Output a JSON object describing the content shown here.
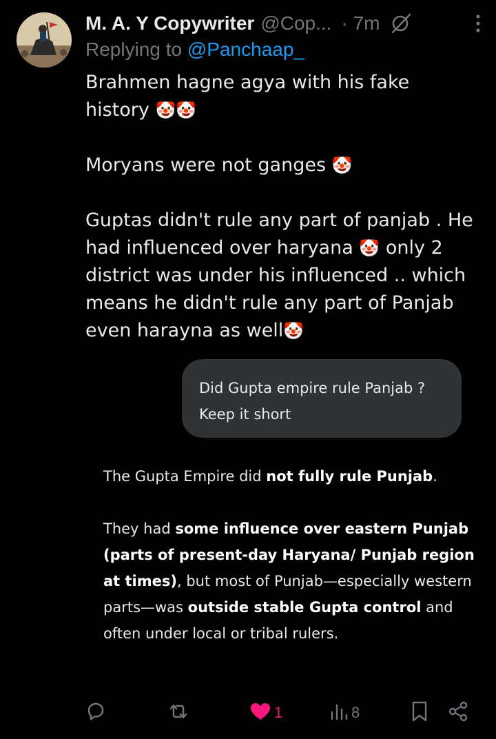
{
  "tweet": {
    "author_name": "M. A. Y Copywriter",
    "author_handle": "@Cop...",
    "time": "· 7m",
    "replying_prefix": "Replying to",
    "replying_to": "@Panchaap_",
    "text": {
      "line1": "Brahmen hagne agya with his fake",
      "line2": "history",
      "line3": "Moryans were not ganges",
      "line4": "Guptas didn't rule any part of panjab . He",
      "line5a": "had influenced over haryana",
      "line5b": "only  2",
      "line6": "district was under his influenced .. which",
      "line7": "means he didn't rule any part of Panjab",
      "line8": "even harayna as well"
    },
    "emoji": "🤡"
  },
  "prompt_bubble": {
    "line1": "Did Gupta empire rule Panjab ?",
    "line2": "Keep it short"
  },
  "answer": {
    "p1_a": "The Gupta Empire did ",
    "p1_b": "not fully rule Punjab",
    "p1_c": ".",
    "p2_a": "They had ",
    "p2_b": "some influence over eastern Punjab (parts of present-day Haryana/ Punjab region at times)",
    "p2_c": ", but most of Punjab—especially western parts—was ",
    "p2_d": "outside stable Gupta control",
    "p2_e": " and often under local or tribal rulers."
  },
  "actions": {
    "reply_count": "",
    "repost_count": "",
    "like_count": "1",
    "views_count": "8"
  },
  "icons": {
    "reply": "reply-icon",
    "repost": "repost-icon",
    "like": "heart-icon",
    "views": "views-icon",
    "bookmark": "bookmark-icon",
    "share": "share-icon",
    "grok": "grok-icon",
    "more": "more-icon"
  },
  "colors": {
    "background": "#000000",
    "text": "#e7e9ea",
    "muted": "#71767b",
    "mention": "#1d9bf0",
    "like": "#f91880",
    "bubble": "#2f3336"
  }
}
